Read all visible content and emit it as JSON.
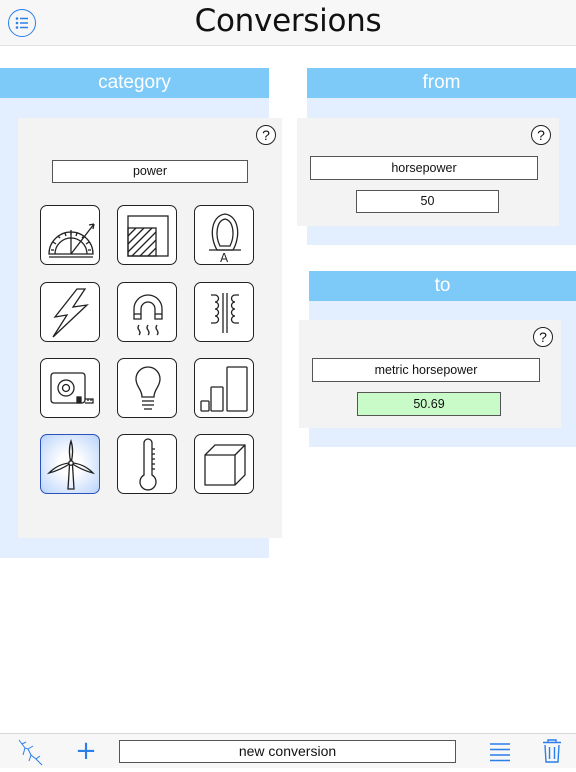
{
  "header": {
    "title": "Conversions",
    "menu_icon": "list-circle-icon"
  },
  "category_panel": {
    "heading": "category",
    "help_label": "?",
    "selected_category": "power",
    "tiles": [
      {
        "icon": "protractor-angle-icon",
        "selected": false
      },
      {
        "icon": "area-icon",
        "selected": false
      },
      {
        "icon": "ammeter-current-icon",
        "selected": false
      },
      {
        "icon": "lightning-energy-icon",
        "selected": false
      },
      {
        "icon": "magnet-heat-icon",
        "selected": false
      },
      {
        "icon": "transformer-icon",
        "selected": false
      },
      {
        "icon": "tape-measure-length-icon",
        "selected": false
      },
      {
        "icon": "light-bulb-icon",
        "selected": false
      },
      {
        "icon": "size-bars-icon",
        "selected": false
      },
      {
        "icon": "wind-turbine-power-icon",
        "selected": true
      },
      {
        "icon": "thermometer-temperature-icon",
        "selected": false
      },
      {
        "icon": "cube-volume-icon",
        "selected": false
      }
    ]
  },
  "from_panel": {
    "heading": "from",
    "help_label": "?",
    "unit": "horsepower",
    "value": "50"
  },
  "to_panel": {
    "heading": "to",
    "help_label": "?",
    "unit": "metric horsepower",
    "value": "50.69"
  },
  "toolbar": {
    "conversion_name": "new conversion",
    "add_label": "+",
    "left_icon": "lightning-tree-icon",
    "list_icon": "list-lines-icon",
    "trash_icon": "trash-icon"
  },
  "colors": {
    "panel_header": "#7dcaf8",
    "panel_bg": "#e3eefe",
    "result_bg": "#c8fbc8",
    "accent": "#2a7fe8"
  }
}
